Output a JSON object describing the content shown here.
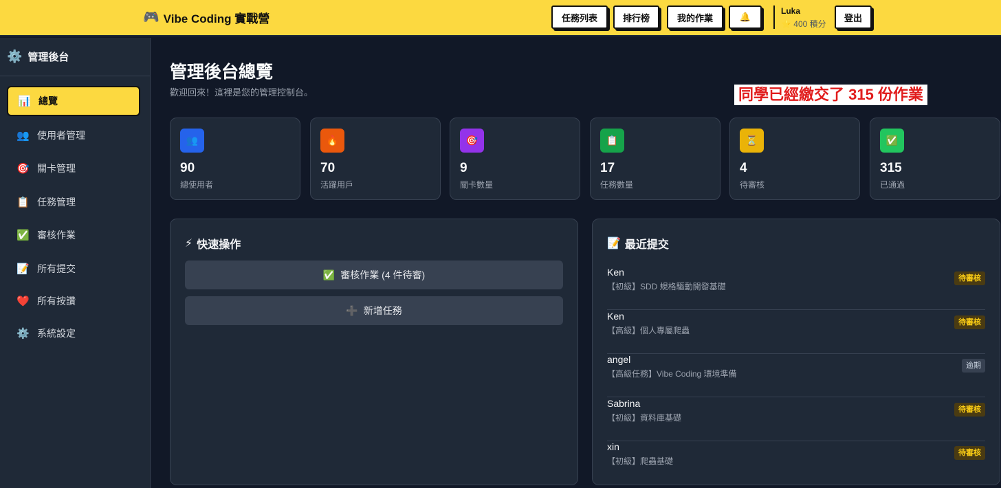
{
  "header": {
    "brand_icon": "🎮",
    "brand": "Vibe Coding 實戰營",
    "nav": [
      "任務列表",
      "排行榜",
      "我的作業"
    ],
    "bell_icon": "🔔",
    "user_name": "Luka",
    "points": "⭐ 400 積分",
    "logout": "登出"
  },
  "sidebar": {
    "title_icon": "⚙️",
    "title": "管理後台",
    "items": [
      {
        "icon": "📊",
        "label": "總覽",
        "active": true
      },
      {
        "icon": "👥",
        "label": "使用者管理"
      },
      {
        "icon": "🎯",
        "label": "關卡管理"
      },
      {
        "icon": "📋",
        "label": "任務管理"
      },
      {
        "icon": "✅",
        "label": "審核作業"
      },
      {
        "icon": "📝",
        "label": "所有提交"
      },
      {
        "icon": "❤️",
        "label": "所有按讚"
      },
      {
        "icon": "⚙️",
        "label": "系統設定"
      }
    ]
  },
  "main": {
    "title": "管理後台總覽",
    "subtitle": "歡迎回來！這裡是您的管理控制台。",
    "promo": "同學已經繳交了 315 份作業"
  },
  "stats": [
    {
      "icon": "👥",
      "color": "#2563eb",
      "value": "90",
      "label": "總使用者"
    },
    {
      "icon": "🔥",
      "color": "#ea580c",
      "value": "70",
      "label": "活躍用戶"
    },
    {
      "icon": "🎯",
      "color": "#9333ea",
      "value": "9",
      "label": "關卡數量"
    },
    {
      "icon": "📋",
      "color": "#16a34a",
      "value": "17",
      "label": "任務數量"
    },
    {
      "icon": "⏳",
      "color": "#eab308",
      "value": "4",
      "label": "待審核"
    },
    {
      "icon": "✅",
      "color": "#22c55e",
      "value": "315",
      "label": "已通過"
    }
  ],
  "quick_actions": {
    "title_icon": "⚡",
    "title": "快速操作",
    "buttons": [
      {
        "icon": "✅",
        "label": "審核作業 (4 件待審)"
      },
      {
        "icon": "➕",
        "label": "新增任務"
      }
    ]
  },
  "recent": {
    "title_icon": "📝",
    "title": "最近提交",
    "rows": [
      {
        "name": "Ken",
        "task": "【初級】SDD 規格驅動開發基礎",
        "status": "待審核",
        "kind": "pending"
      },
      {
        "name": "Ken",
        "task": "【高級】個人專屬爬蟲",
        "status": "待審核",
        "kind": "pending"
      },
      {
        "name": "angel",
        "task": "【高級任務】Vibe Coding 環境準備",
        "status": "逾期",
        "kind": "expired"
      },
      {
        "name": "Sabrina",
        "task": "【初級】資料庫基礎",
        "status": "待審核",
        "kind": "pending"
      },
      {
        "name": "xin",
        "task": "【初級】爬蟲基礎",
        "status": "待審核",
        "kind": "pending"
      }
    ]
  }
}
